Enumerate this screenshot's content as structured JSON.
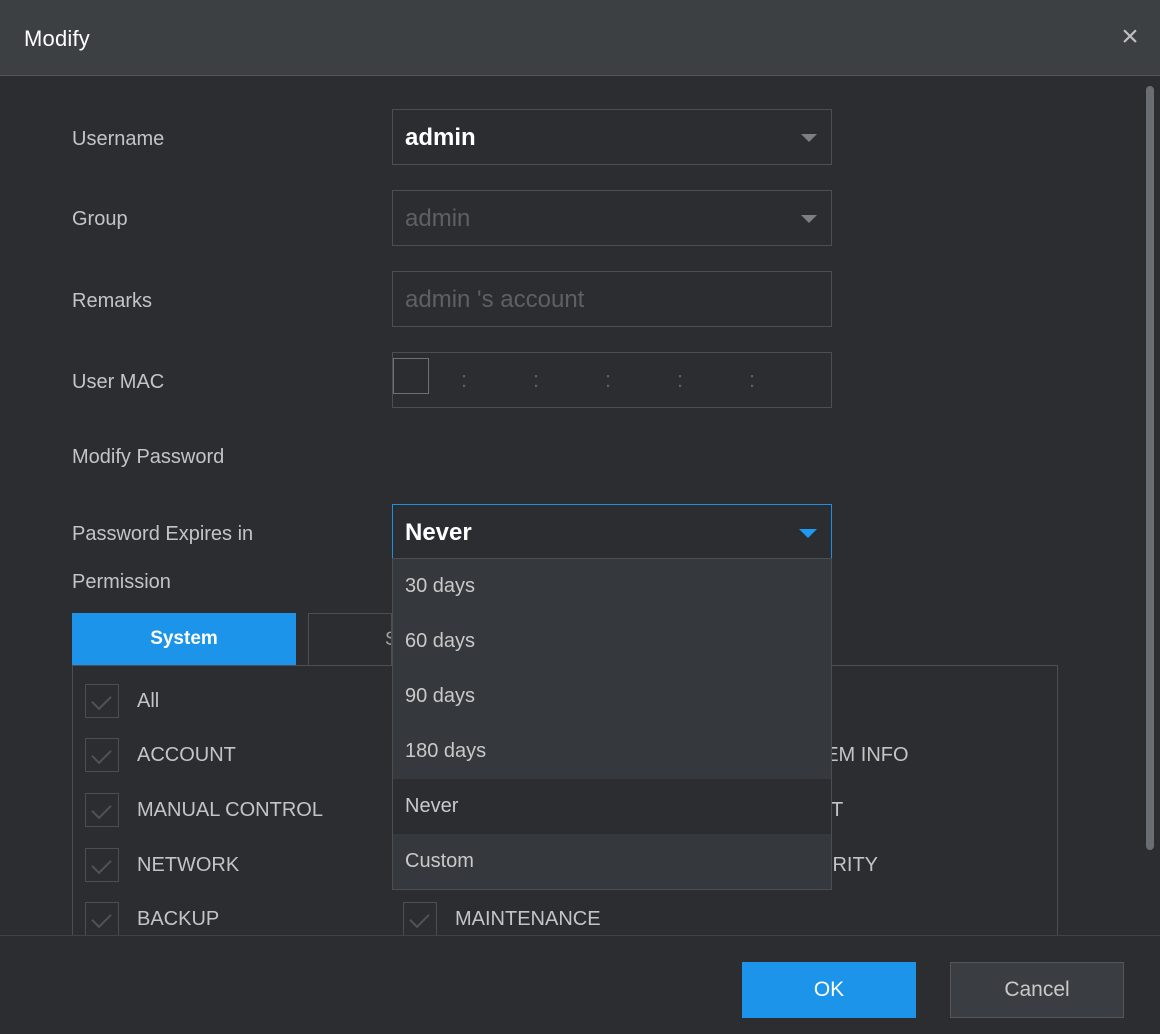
{
  "dialog": {
    "title": "Modify",
    "close_icon": "×"
  },
  "form": {
    "username": {
      "label": "Username",
      "value": "admin"
    },
    "group": {
      "label": "Group",
      "value": "admin"
    },
    "remarks": {
      "label": "Remarks",
      "value": "admin 's account"
    },
    "user_mac": {
      "label": "User MAC",
      "separator": ":"
    },
    "modify_password": {
      "label": "Modify Password",
      "checked": false
    },
    "password_expires": {
      "label": "Password Expires in",
      "value": "Never",
      "options": [
        "30 days",
        "60 days",
        "90 days",
        "180 days",
        "Never",
        "Custom"
      ]
    },
    "permission": {
      "label": "Permission"
    }
  },
  "tabs": {
    "system": "System",
    "second_partial": "S"
  },
  "permissions": {
    "col1": [
      "All",
      "ACCOUNT",
      "MANUAL CONTROL",
      "NETWORK",
      "BACKUP"
    ],
    "col2": [
      "MAINTENANCE"
    ],
    "col3_partial": [
      "TEM INFO",
      "T",
      "URITY"
    ]
  },
  "buttons": {
    "ok": "OK",
    "cancel": "Cancel"
  },
  "colors": {
    "accent": "#1b94ea",
    "background": "#2b2d31",
    "titlebar": "#3d4043"
  }
}
